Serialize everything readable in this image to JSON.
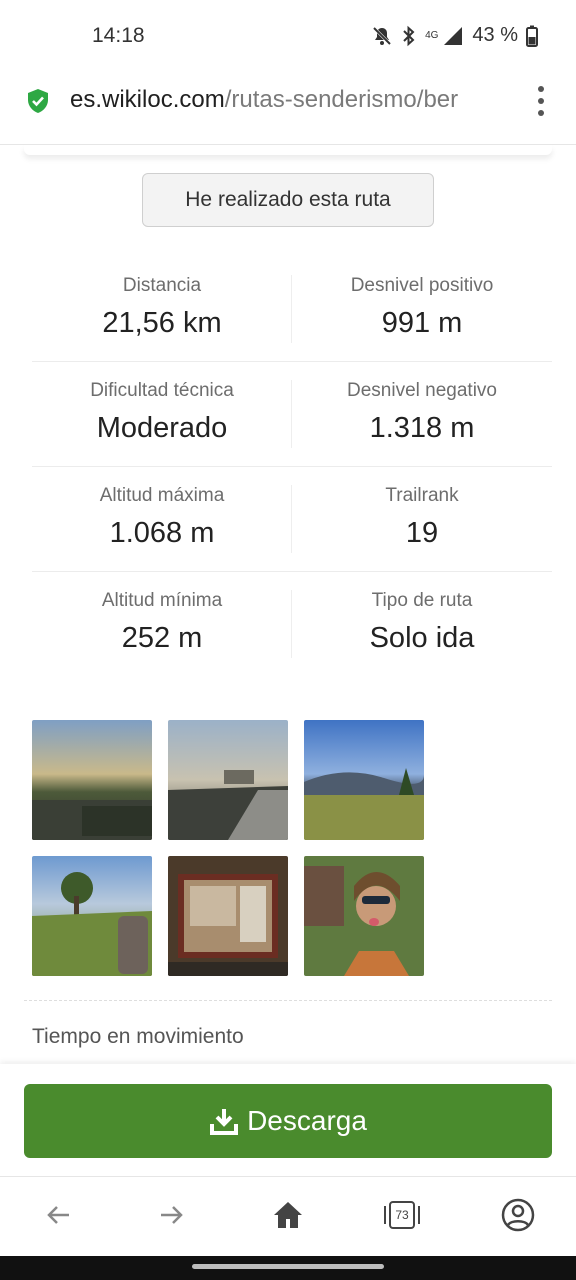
{
  "status_bar": {
    "time": "14:18",
    "network": "4G",
    "battery": "43 %"
  },
  "browser": {
    "url_domain": "es.wikiloc.com",
    "url_path": "/rutas-senderismo/ber",
    "secure_icon": "shield-check-icon",
    "tab_count": "73"
  },
  "page": {
    "done_button_label": "He realizado esta ruta",
    "stats": [
      {
        "label": "Distancia",
        "value": "21,56 km"
      },
      {
        "label": "Desnivel positivo",
        "value": "991 m"
      },
      {
        "label": "Dificultad técnica",
        "value": "Moderado"
      },
      {
        "label": "Desnivel negativo",
        "value": "1.318 m"
      },
      {
        "label": "Altitud máxima",
        "value": "1.068 m"
      },
      {
        "label": "Trailrank",
        "value": "19"
      },
      {
        "label": "Altitud mínima",
        "value": "252 m"
      },
      {
        "label": "Tipo de ruta",
        "value": "Solo ida"
      }
    ],
    "moving_time_label": "Tiempo en movimiento",
    "download_label": "Descarga"
  },
  "colors": {
    "brand_green": "#4a8b2d",
    "secure_green": "#2ea843"
  }
}
